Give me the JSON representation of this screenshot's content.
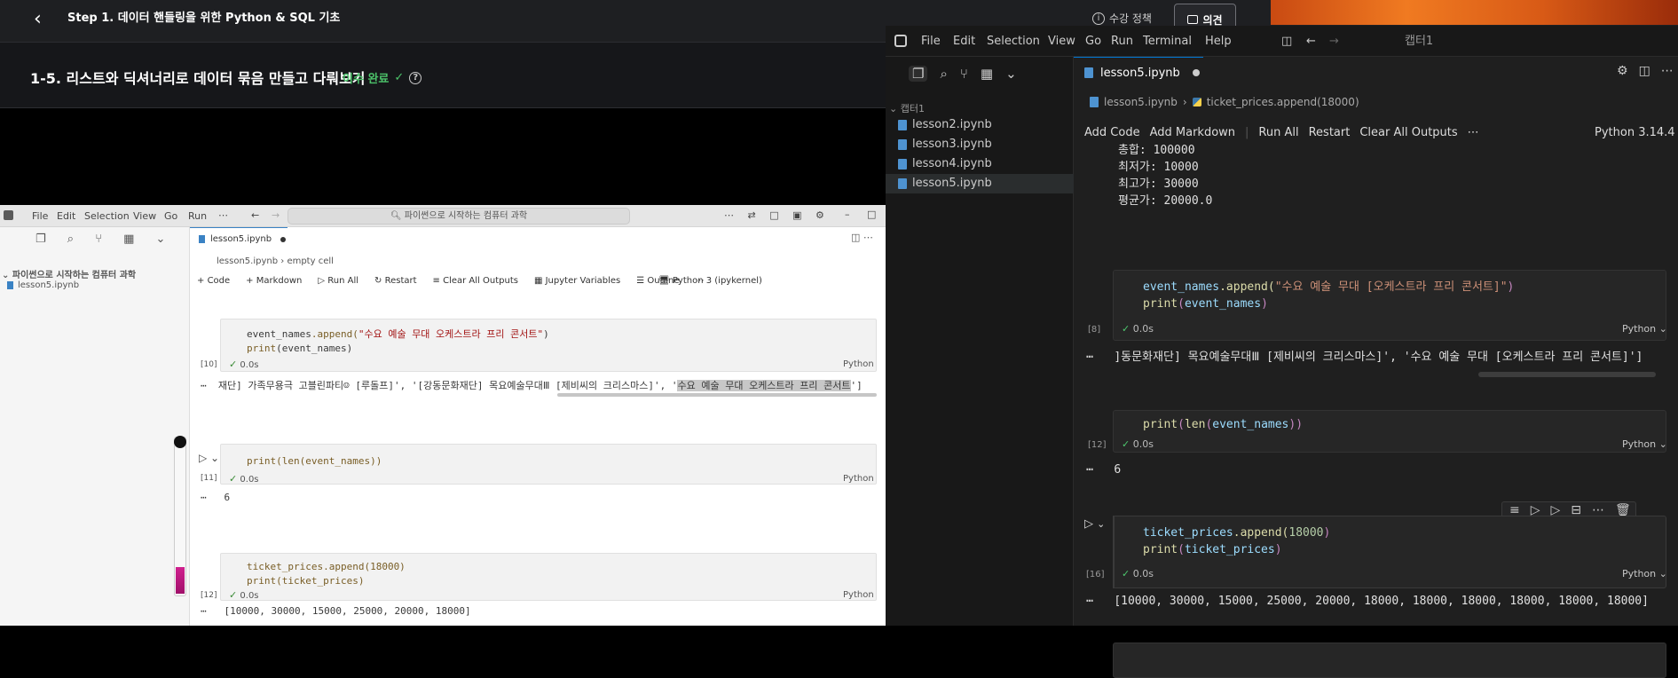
{
  "course": {
    "title": "Step 1. 데이터 핸들링을 위한 Python & SQL 기초",
    "policy": "수강 정책",
    "feedback": "의견",
    "lesson_title": "1-5. 리스트와 딕셔너리로 데이터 묶음 만들고 다뤄보기",
    "lesson_status": "이수 완료"
  },
  "video": {
    "menu": [
      "File",
      "Edit",
      "Selection",
      "View",
      "Go",
      "Run"
    ],
    "search": "파이썬으로 시작하는 컴퓨터 과학",
    "explorer_title": "파이썬으로 시작하는 컴퓨터 과학",
    "explorer_file": "lesson5.ipynb",
    "tab": "lesson5.ipynb",
    "breadcrumb_file": "lesson5.ipynb",
    "breadcrumb_cell": "empty cell",
    "toolbar": {
      "code": "Code",
      "markdown": "Markdown",
      "run_all": "Run All",
      "restart": "Restart",
      "clear": "Clear All Outputs",
      "variables": "Jupyter Variables",
      "outline": "Outline",
      "kernel": "Python 3 (ipykernel)"
    },
    "cells": [
      {
        "count": "[10]",
        "line1_obj": "event_names",
        "line1_fn": ".append(",
        "line1_str": "\"수요 예술 무대 오케스트라 프리 콘서트\"",
        "line1_end": ")",
        "line2_fn": "print",
        "line2_arg": "(event_names)",
        "time": "0.0s",
        "lang": "Python",
        "output": "재단] 가족무용극 고블린파티☺ [루돌프]', '[강동문화재단] 목요예술무대Ⅲ [제비씨의 크리스마스]', '",
        "output_hl": "수요 예술 무대 오케스트라 프리 콘서트",
        "output_end": "']"
      },
      {
        "count": "[11]",
        "code": "print(len(event_names))",
        "time": "0.0s",
        "lang": "Python",
        "output": "6"
      },
      {
        "count": "[12]",
        "line1": "ticket_prices.append(18000)",
        "line2": "print(ticket_prices)",
        "time": "0.0s",
        "lang": "Python",
        "output": "[10000, 30000, 15000, 25000, 20000, 18000]"
      }
    ]
  },
  "vscode": {
    "menu": [
      "File",
      "Edit",
      "Selection",
      "View",
      "Go",
      "Run",
      "Terminal",
      "Help"
    ],
    "window_title": "캡터1",
    "explorer_root": "캡터1",
    "files": [
      "lesson2.ipynb",
      "lesson3.ipynb",
      "lesson4.ipynb",
      "lesson5.ipynb"
    ],
    "tab": "lesson5.ipynb",
    "breadcrumb_file": "lesson5.ipynb",
    "breadcrumb_cell": "ticket_prices.append(18000)",
    "toolbar": {
      "add_code": "Add Code",
      "add_markdown": "Add Markdown",
      "run_all": "Run All",
      "restart": "Restart",
      "clear": "Clear All Outputs",
      "kernel": "Python 3.14.4"
    },
    "prev_output": [
      "총합: 100000",
      "최저가: 10000",
      "최고가: 30000",
      "평균가: 20000.0"
    ],
    "cells": [
      {
        "count": "[8]",
        "obj": "event_names",
        "fn": ".append(",
        "str": "\"수요 예술 무대 [오케스트라 프리 콘서트]\"",
        "end": ")",
        "print": "print",
        "arg": "event_names",
        "time": "0.0s",
        "lang": "Python",
        "output": "]동문화재단] 목요예술무대Ⅲ [제비씨의 크리스마스]', '수요 예술 무대 [오케스트라 프리 콘서트]']"
      },
      {
        "count": "[12]",
        "print": "print",
        "len": "len",
        "arg": "event_names",
        "time": "0.0s",
        "lang": "Python",
        "output": "6"
      },
      {
        "count": "[16]",
        "obj": "ticket_prices",
        "fn": ".append(",
        "num": "18000",
        "end": ")",
        "print": "print",
        "arg": "ticket_prices",
        "time": "0.0s",
        "lang": "Python",
        "output": "[10000, 30000, 15000, 25000, 20000, 18000, 18000, 18000, 18000, 18000, 18000]"
      }
    ]
  },
  "colors": {
    "accent_green": "#4cc36a",
    "orange": "#f07a21"
  }
}
